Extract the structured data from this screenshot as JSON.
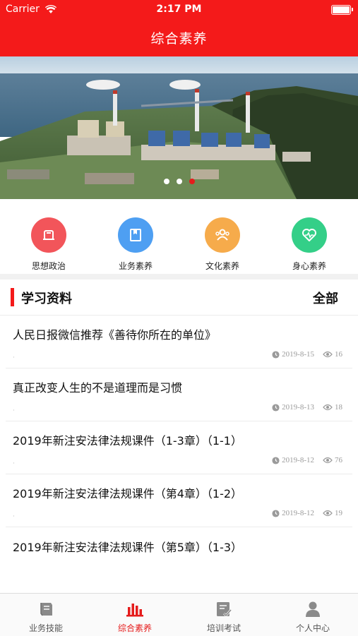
{
  "status": {
    "carrier": "Carrier",
    "time": "2:17 PM"
  },
  "header": {
    "title": "综合素养"
  },
  "banner": {
    "dots": 3,
    "active_dot": 2
  },
  "categories": [
    {
      "label": "思想政治",
      "icon": "ribbon-icon",
      "color": "#f2555a"
    },
    {
      "label": "业务素养",
      "icon": "book-icon",
      "color": "#4e9ff2"
    },
    {
      "label": "文化素养",
      "icon": "people-icon",
      "color": "#f6ab4b"
    },
    {
      "label": "身心素养",
      "icon": "heart-pulse-icon",
      "color": "#34cf88"
    }
  ],
  "section": {
    "title": "学习资料",
    "all_label": "全部"
  },
  "articles": [
    {
      "title": "人民日报微信推荐《善待你所在的单位》",
      "tick": "·",
      "date": "2019-8-15",
      "views": "16"
    },
    {
      "title": "真正改变人生的不是道理而是习惯",
      "tick": "·",
      "date": "2019-8-13",
      "views": "18"
    },
    {
      "title": "2019年新注安法律法规课件（1-3章）（1-1）",
      "tick": "·",
      "date": "2019-8-12",
      "views": "76"
    },
    {
      "title": "2019年新注安法律法规课件（第4章）（1-2）",
      "tick": "·",
      "date": "2019-8-12",
      "views": "19"
    },
    {
      "title": "2019年新注安法律法规课件（第5章）（1-3）"
    }
  ],
  "tabs": [
    {
      "label": "业务技能",
      "icon": "book-stack-icon"
    },
    {
      "label": "综合素养",
      "icon": "bar-chart-icon"
    },
    {
      "label": "培训考试",
      "icon": "exam-icon"
    },
    {
      "label": "个人中心",
      "icon": "person-icon"
    }
  ],
  "colors": {
    "brand_red": "#f41a1a",
    "active_tab": "#e51c1c"
  }
}
